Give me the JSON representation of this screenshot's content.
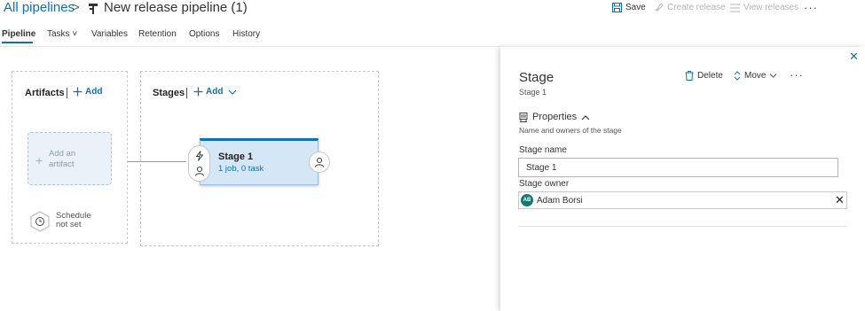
{
  "header": {
    "breadcrumb": "All pipelines",
    "separator": ">",
    "title": "New release pipeline (1)",
    "save_label": "Save",
    "create_release_label": "Create release",
    "view_releases_label": "View releases",
    "more_label": "···"
  },
  "tabs": [
    {
      "label": "Pipeline",
      "active": true
    },
    {
      "label": "Tasks ˅",
      "active": false
    },
    {
      "label": "Variables",
      "active": false
    },
    {
      "label": "Retention",
      "active": false
    },
    {
      "label": "Options",
      "active": false
    },
    {
      "label": "History",
      "active": false
    }
  ],
  "artifacts": {
    "title": "Artifacts",
    "add_label": "Add",
    "placeholder_line1": "Add an",
    "placeholder_line2": "artifact",
    "schedule_line1": "Schedule",
    "schedule_line2": "not set"
  },
  "stages": {
    "title": "Stages",
    "add_label": "Add",
    "stage_name": "Stage 1",
    "stage_summary": "1 job, 0 task"
  },
  "panel": {
    "close_label": "✕",
    "title": "Stage",
    "subtitle": "Stage 1",
    "delete_label": "Delete",
    "move_label": "Move",
    "more_label": "···",
    "properties_label": "Properties",
    "properties_description": "Name and owners of the stage",
    "stage_name_label": "Stage name",
    "stage_name_value": "Stage 1",
    "stage_owner_label": "Stage owner",
    "owner_initials": "AB",
    "owner_name": "Adam Borsi",
    "clear_label": "✕"
  },
  "colors": {
    "accent": "#106ebe",
    "stage_card_bg": "#d5e6f6",
    "owner_avatar": "#107c6f"
  },
  "icons": [
    "save-icon",
    "rocket-icon",
    "list-icon",
    "pipeline-icon",
    "plus-icon",
    "clock-icon",
    "lightning-icon",
    "person-icon",
    "trash-icon",
    "move-arrows-icon",
    "chevron-down-icon",
    "chevron-up-icon",
    "beaker-icon",
    "close-icon"
  ]
}
